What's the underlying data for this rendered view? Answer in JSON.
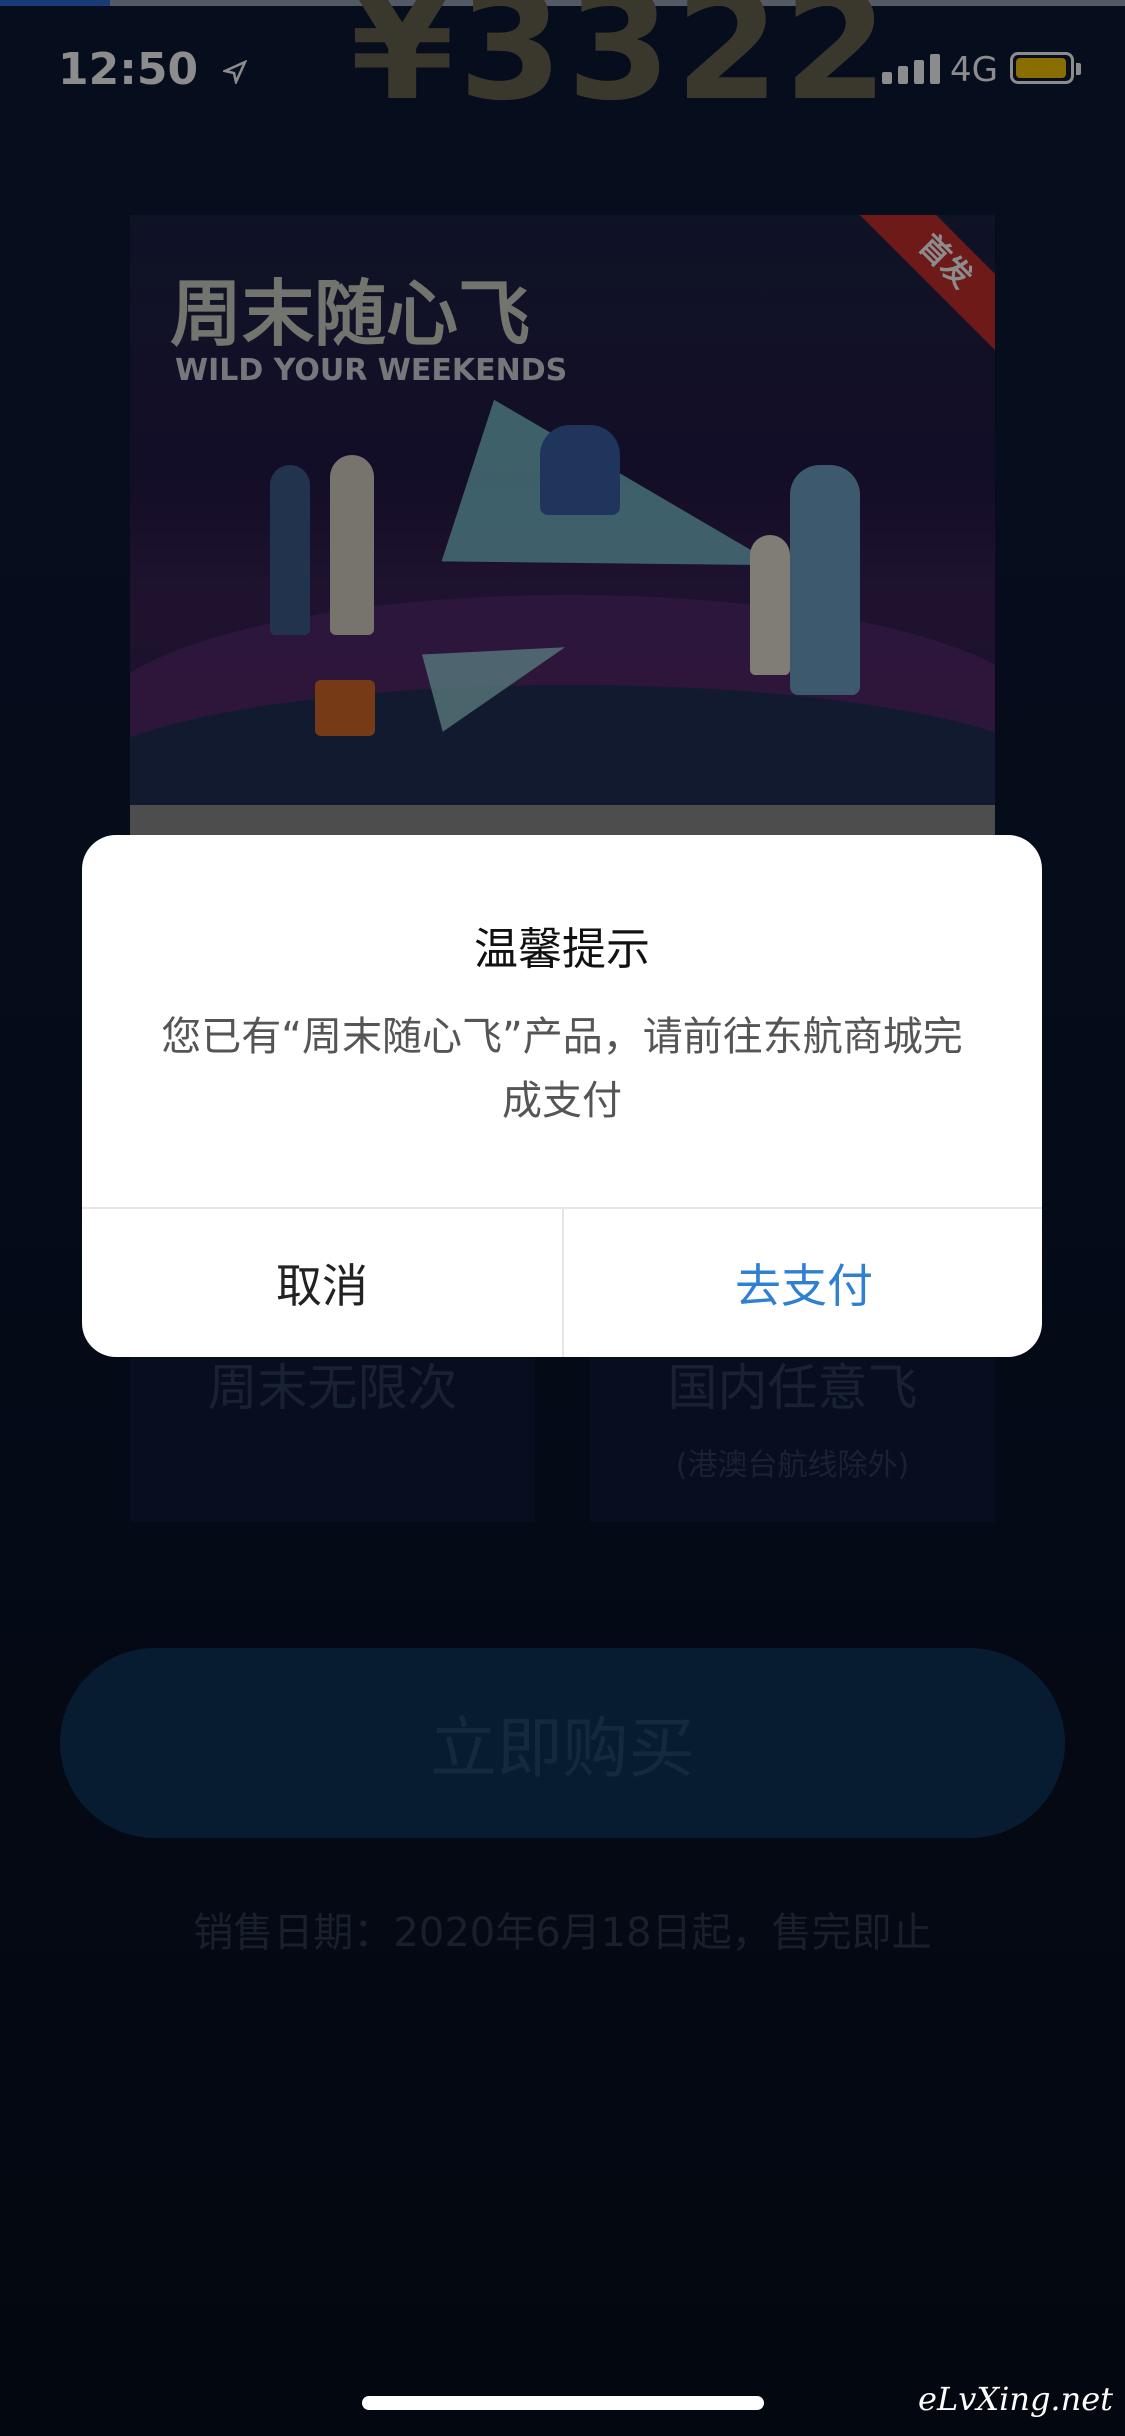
{
  "status_bar": {
    "time": "12:50",
    "network": "4G"
  },
  "background": {
    "price_partial": "¥3322"
  },
  "banner": {
    "title": "周末随心飞",
    "subtitle": "WILD YOUR WEEKENDS",
    "corner_badge": "首发"
  },
  "features": [
    {
      "title": "周末无限次",
      "note": ""
    },
    {
      "title": "国内任意飞",
      "note": "(港澳台航线除外)"
    }
  ],
  "buy_button": {
    "label": "立即购买"
  },
  "sale_date": "销售日期：2020年6月18日起，售完即止",
  "dialog": {
    "title": "温馨提示",
    "message": "您已有“周末随心飞”产品，请前往东航商城完成支付",
    "cancel_label": "取消",
    "confirm_label": "去支付"
  },
  "watermark": "eLvXing.net",
  "colors": {
    "accent": "#2f7fd2",
    "battery": "#f7c600",
    "badge": "#c8302f"
  }
}
